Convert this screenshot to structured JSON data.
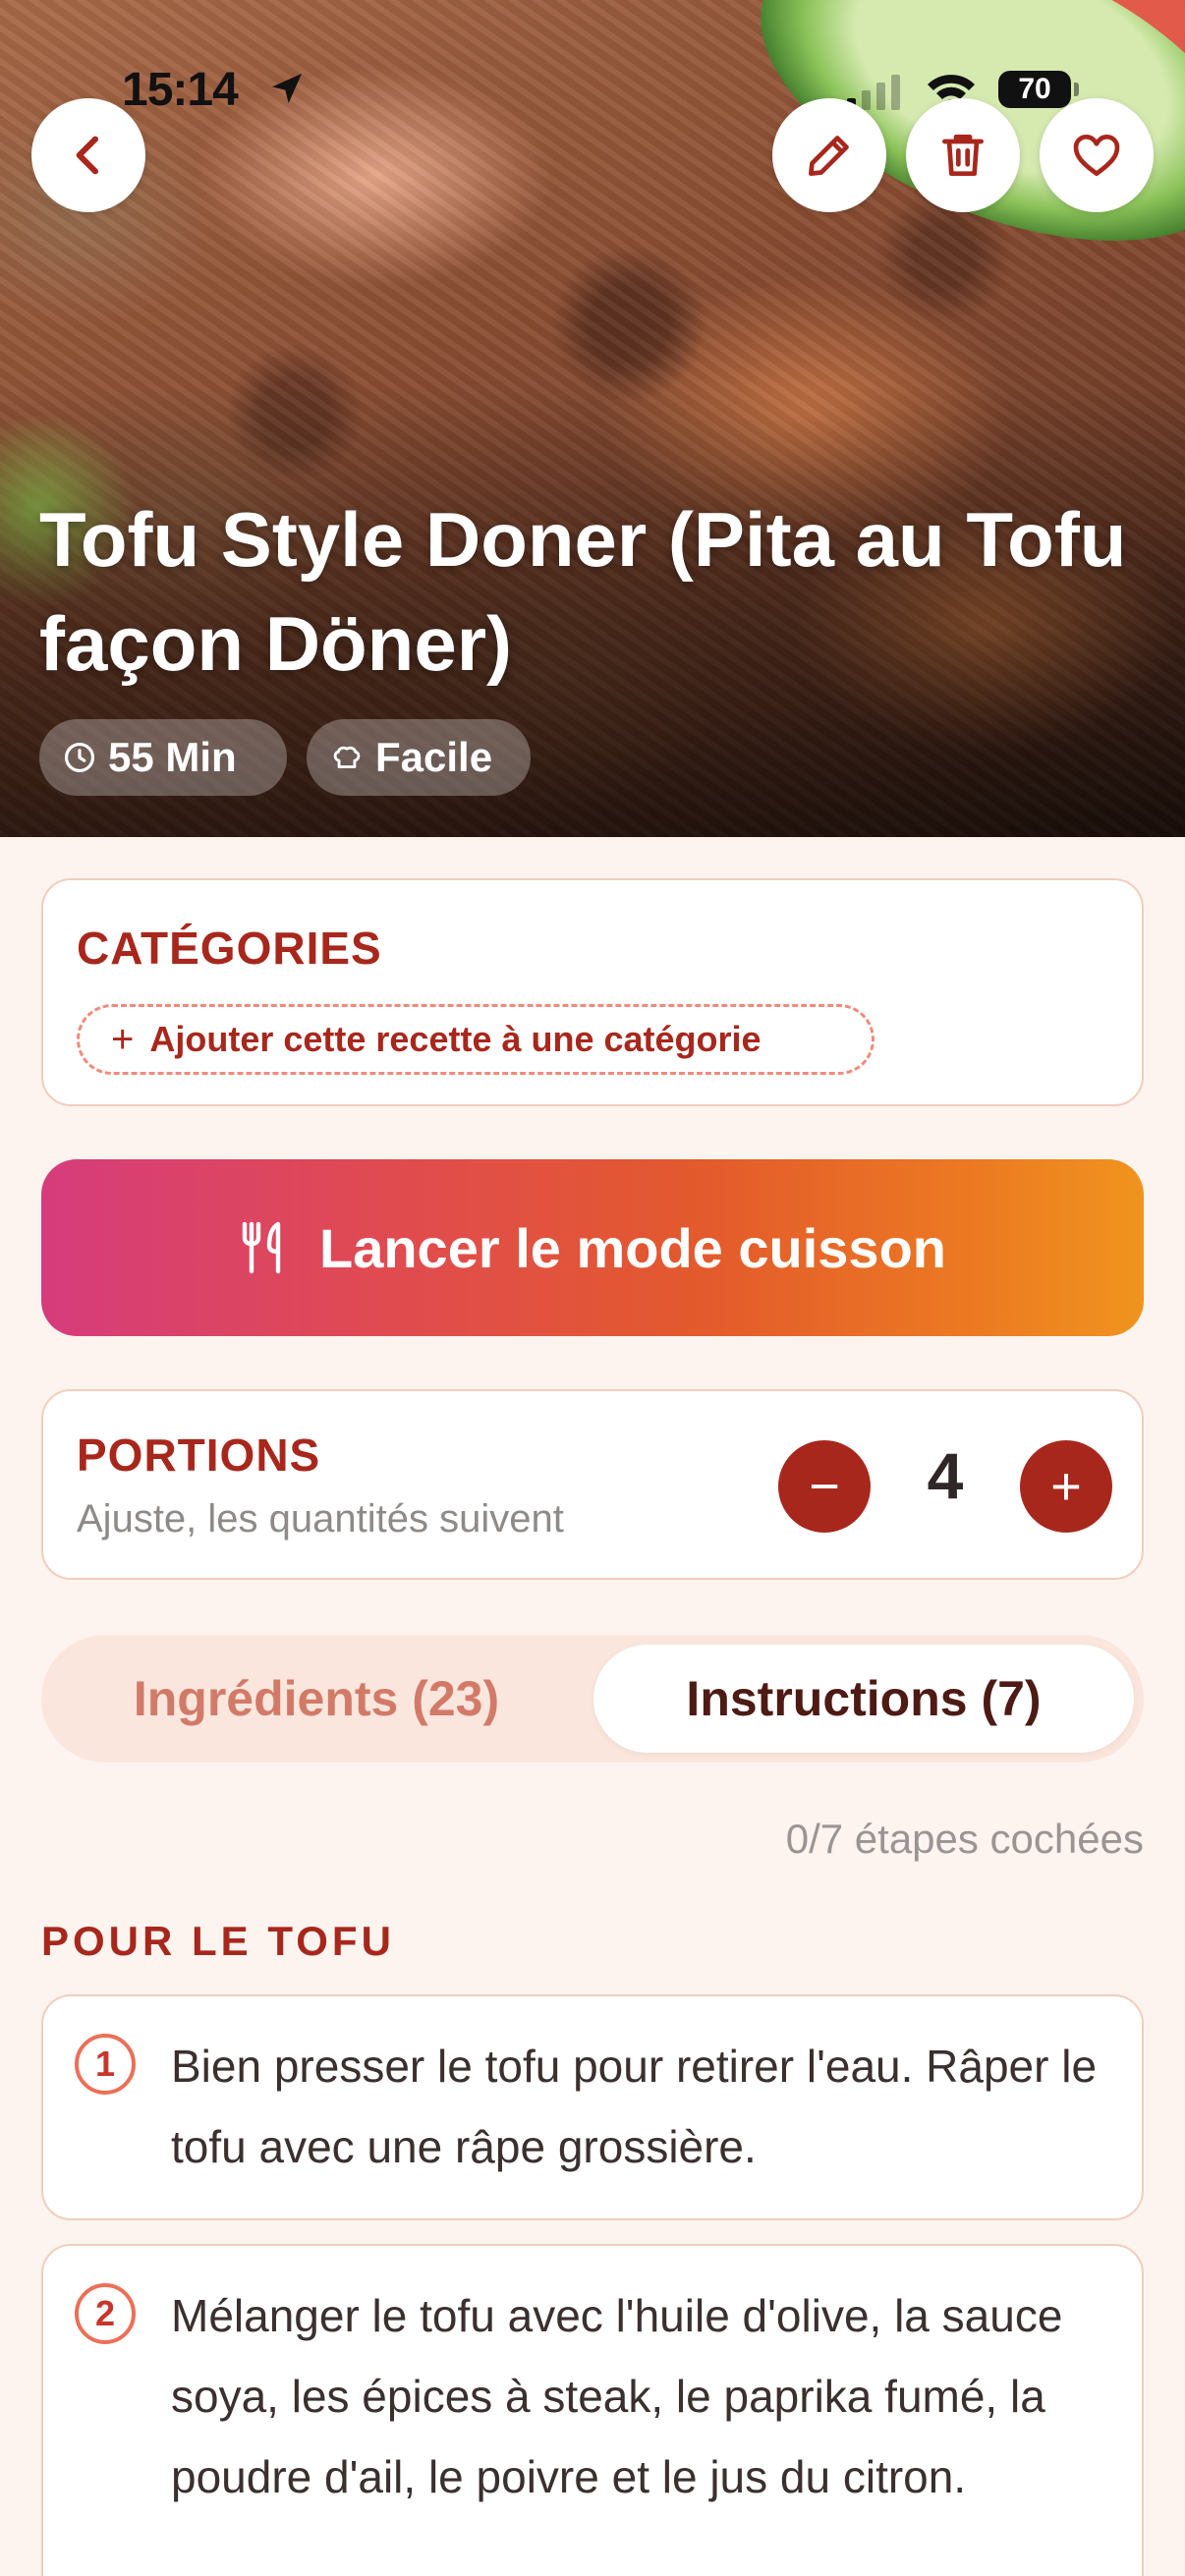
{
  "status_bar": {
    "time": "15:14",
    "battery": "70"
  },
  "header": {
    "icons": [
      "chevron-left-icon",
      "pencil-icon",
      "trash-icon",
      "heart-icon"
    ]
  },
  "recipe": {
    "title": "Tofu Style Doner (Pita au Tofu façon Döner)",
    "time": "55 Min",
    "difficulty": "Facile"
  },
  "categories": {
    "title": "CATÉGORIES",
    "add_label": "Ajouter cette recette à une catégorie"
  },
  "cook_mode": {
    "label": "Lancer le mode cuisson"
  },
  "portions": {
    "title": "PORTIONS",
    "subtitle": "Ajuste, les quantités suivent",
    "value": "4",
    "minus": "−",
    "plus": "+"
  },
  "tabs": [
    {
      "label": "Ingrédients (23)",
      "active": false
    },
    {
      "label": "Instructions (7)",
      "active": true
    }
  ],
  "instructions": {
    "progress": "0/7 étapes cochées",
    "group_title": "POUR LE TOFU",
    "steps": [
      {
        "number": "1",
        "text": "Bien presser le tofu pour retirer l'eau. Râper le tofu avec une râpe grossière."
      },
      {
        "number": "2",
        "text": "Mélanger le tofu avec l'huile d'olive, la sauce soya, les épices à steak, le paprika fumé, la poudre d'ail, le poivre et le jus du citron."
      }
    ]
  },
  "colors": {
    "accent": "#a8271c",
    "background": "#fdf4ef",
    "gradient_start": "#d63c7c",
    "gradient_end": "#f0941e"
  }
}
